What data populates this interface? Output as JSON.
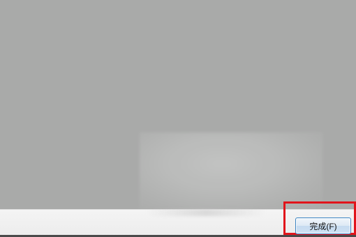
{
  "dialog": {
    "finish_button_label": "完成(F)"
  },
  "colors": {
    "background": "#aaabaa",
    "footer": "#f0f0f0",
    "highlight": "#e1141b",
    "button_border": "#3b84c2"
  }
}
